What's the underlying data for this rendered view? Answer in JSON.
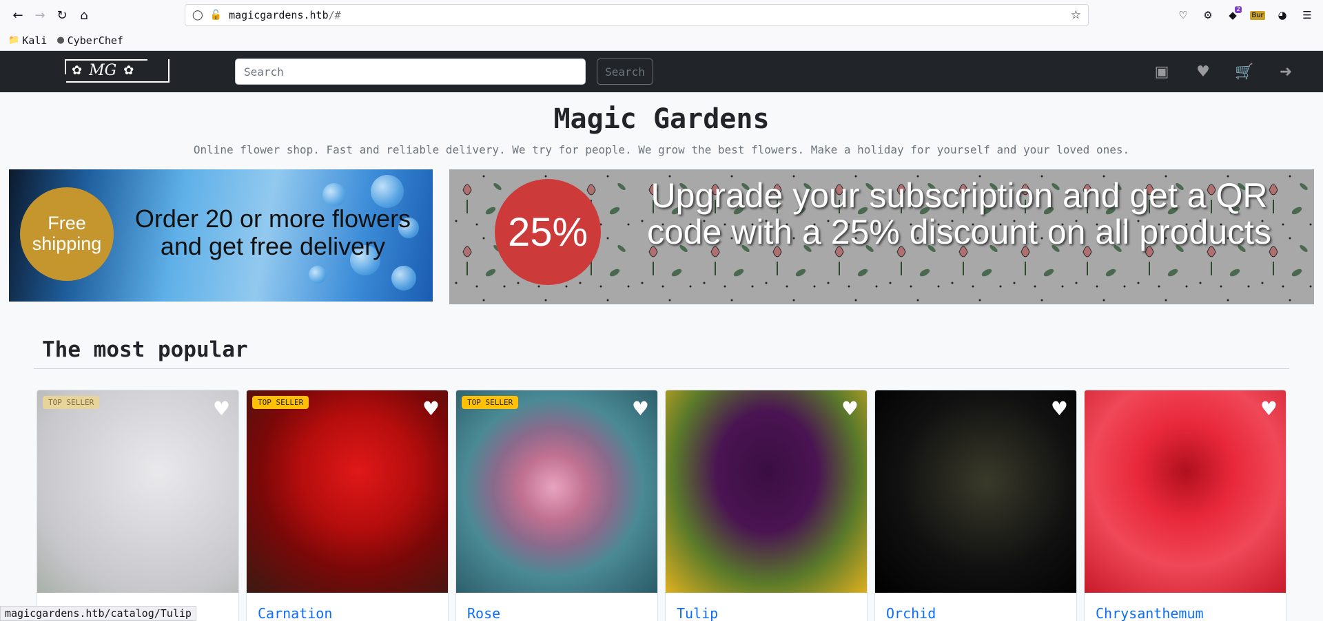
{
  "browser": {
    "url_host": "magicgardens.htb",
    "url_rest": "/#",
    "bookmarks": [
      {
        "label": "Kali"
      },
      {
        "label": "CyberChef"
      }
    ],
    "ext_badge": "2",
    "ext_bur": "Bur",
    "status_url": "magicgardens.htb/catalog/Tulip"
  },
  "nav": {
    "logo_text": "MG",
    "search_placeholder": "Search",
    "search_button": "Search"
  },
  "hero": {
    "title": "Magic Gardens",
    "subtitle": "Online flower shop. Fast and reliable delivery. We try for people. We grow the best flowers. Make a holiday for yourself and your loved ones."
  },
  "banners": {
    "shipping_badge": "Free shipping",
    "shipping_text": "Order 20 or more flowers and get free delivery",
    "discount_badge": "25%",
    "discount_text": "Upgrade your subscription and get a QR code with a 25% discount on all products"
  },
  "popular": {
    "title": "The most popular",
    "items": [
      {
        "name": "",
        "badge": "TOP SELLER"
      },
      {
        "name": "Carnation",
        "badge": "TOP SELLER"
      },
      {
        "name": "Rose",
        "badge": "TOP SELLER"
      },
      {
        "name": "Tulip",
        "badge": ""
      },
      {
        "name": "Orchid",
        "badge": ""
      },
      {
        "name": "Chrysanthemum",
        "badge": ""
      }
    ]
  }
}
